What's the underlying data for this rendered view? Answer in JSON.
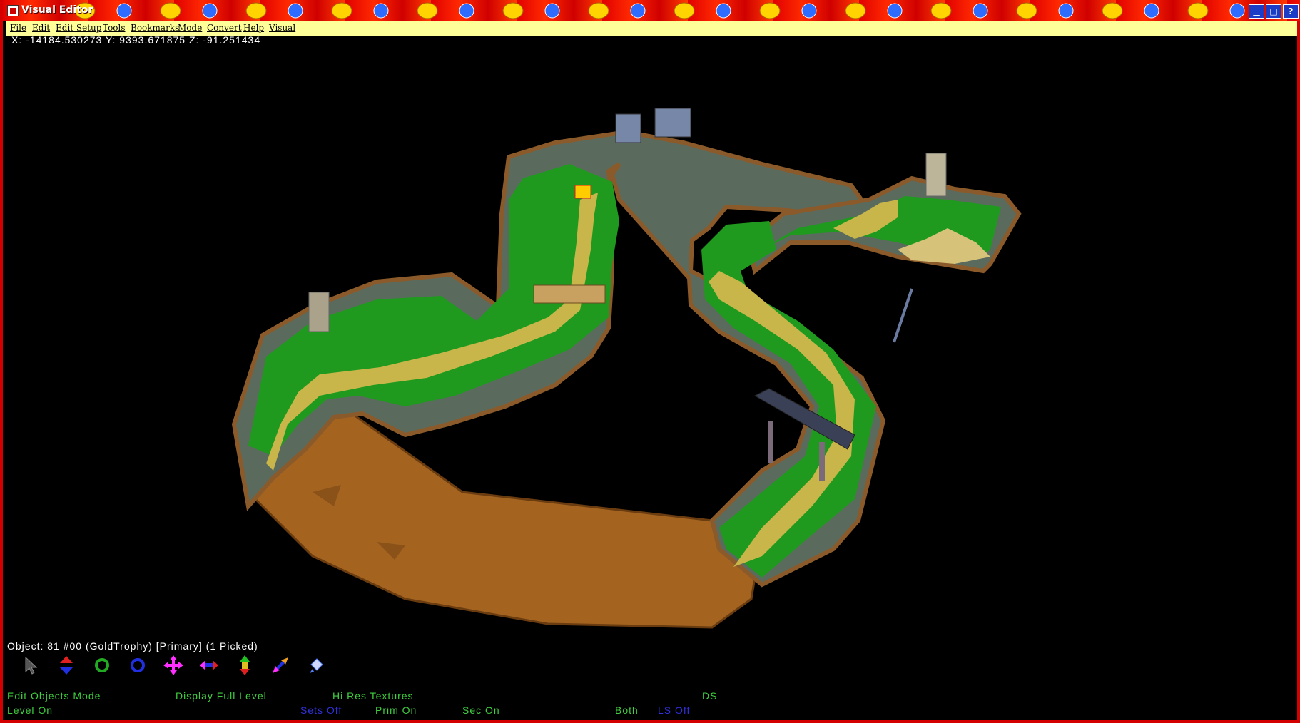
{
  "window": {
    "title": "Visual Editor",
    "controls": {
      "minimize": "▁",
      "maximize": "□",
      "help": "?"
    }
  },
  "menu": [
    "File",
    "Edit",
    "Edit Setup",
    "Tools",
    "Bookmarks",
    "Mode",
    "Convert",
    "Help",
    "Visual"
  ],
  "coords": "X: -14184.530273 Y: 9393.671875 Z: -91.251434",
  "object_status": "Object: 81 #00 (GoldTrophy)  [Primary] (1 Picked)",
  "tools": [
    {
      "name": "select-arrow-icon",
      "color": "#555555"
    },
    {
      "name": "move-vertical-icon",
      "color": "#e02020"
    },
    {
      "name": "rotate-green-icon",
      "color": "#22aa22"
    },
    {
      "name": "rotate-blue-icon",
      "color": "#2030e0"
    },
    {
      "name": "move-all-icon",
      "color": "#ff30ff"
    },
    {
      "name": "scale-horizontal-icon",
      "color": "#ff30ff"
    },
    {
      "name": "scale-vertical-icon",
      "color": "#20c020"
    },
    {
      "name": "scale-diagonal-icon",
      "color": "#f0a020"
    },
    {
      "name": "paint-bucket-icon",
      "color": "#5080ff"
    }
  ],
  "modes": {
    "edit_mode": "Edit Objects Mode",
    "display": "Display Full Level",
    "textures": "Hi Res Textures",
    "ds": "DS",
    "level": "Level On",
    "sets": "Sets Off",
    "prim": "Prim On",
    "sec": "Sec On",
    "both": "Both",
    "ls": "LS Off"
  },
  "colors": {
    "title_red": "#e10000",
    "menu_yellow": "#ffff99",
    "status_green": "#3fcf3f",
    "status_blue": "#3030e0",
    "grass": "#1f9a1f",
    "road": "#c8b64a",
    "dirt": "#a4641f",
    "cliff": "#5a6b5e"
  }
}
